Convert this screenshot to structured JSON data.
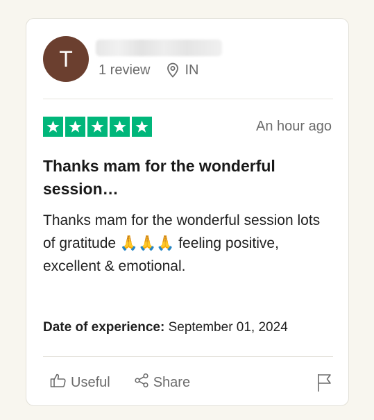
{
  "reviewer": {
    "avatar_letter": "T",
    "avatar_color": "#6b3f2f",
    "review_count": "1 review",
    "location_icon": "location-pin-icon",
    "country": "IN"
  },
  "rating": {
    "stars": 5,
    "max_stars": 5,
    "star_color": "#00b67a",
    "timestamp": "An hour ago"
  },
  "review": {
    "title": "Thanks mam for the wonderful session…",
    "body": "Thanks mam for the wonderful session lots of gratitude 🙏🙏🙏 feeling positive, excellent & emotional.",
    "date_label": "Date of experience:",
    "date_value": "September 01, 2024"
  },
  "actions": {
    "useful_label": "Useful",
    "useful_icon": "thumbs-up-icon",
    "share_label": "Share",
    "share_icon": "share-icon",
    "report_icon": "flag-icon"
  }
}
